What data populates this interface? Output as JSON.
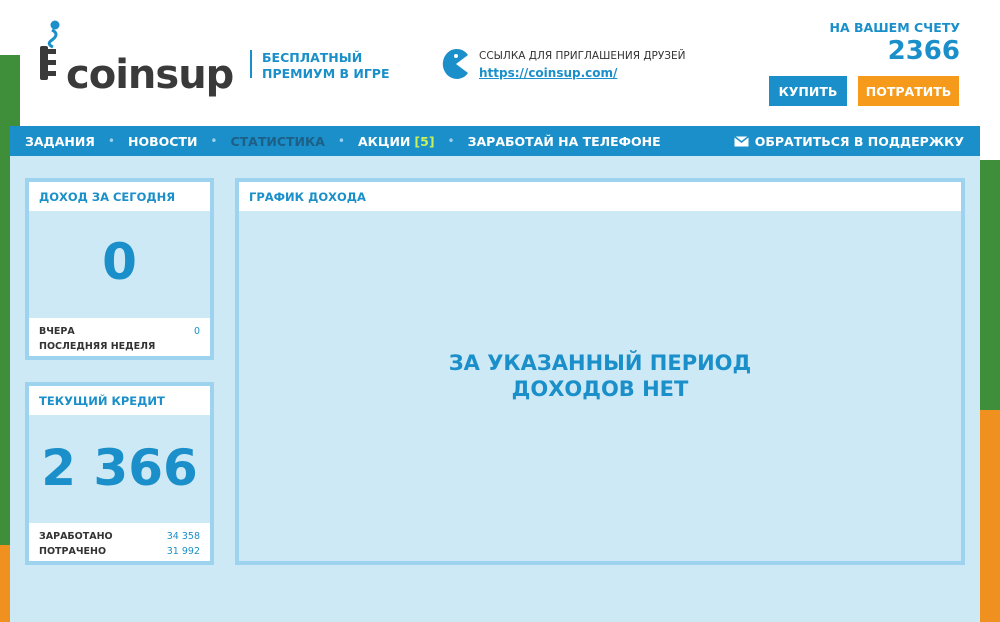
{
  "header": {
    "logo_text": "coinsup",
    "tagline_line1": "БЕСПЛАТНЫЙ",
    "tagline_line2": "ПРЕМИУМ В ИГРЕ",
    "referral_label": "ССЫЛКА ДЛЯ ПРИГЛАШЕНИЯ ДРУЗЕЙ",
    "referral_link": "https://coinsup.com/",
    "account_label": "НА ВАШЕМ СЧЕТУ",
    "account_balance": "2366",
    "buy_label": "КУПИТЬ",
    "spend_label": "ПОТРАТИТЬ"
  },
  "nav": {
    "items": [
      {
        "label": "ЗАДАНИЯ"
      },
      {
        "label": "НОВОСТИ"
      },
      {
        "label": "СТАТИСТИКА",
        "active": true
      },
      {
        "label": "АКЦИИ",
        "badge": "[5]"
      },
      {
        "label": "ЗАРАБОТАЙ НА ТЕЛЕФОНЕ"
      }
    ],
    "support_label": "ОБРАТИТЬСЯ В ПОДДЕРЖКУ"
  },
  "income_today": {
    "title": "ДОХОД ЗА СЕГОДНЯ",
    "value": "0",
    "yesterday_label": "ВЧЕРА",
    "yesterday_value": "0",
    "last_week_label": "ПОСЛЕДНЯЯ НЕДЕЛЯ",
    "last_week_value": ""
  },
  "current_credit": {
    "title": "ТЕКУЩИЙ КРЕДИТ",
    "value": "2 366",
    "earned_label": "ЗАРАБОТАНО",
    "earned_value": "34 358",
    "spent_label": "ПОТРАЧЕНО",
    "spent_value": "31 992"
  },
  "income_chart": {
    "title": "ГРАФИК ДОХОДА",
    "empty_line1": "ЗА УКАЗАННЫЙ ПЕРИОД",
    "empty_line2": "ДОХОДОВ НЕТ"
  },
  "colors": {
    "accent_blue": "#1a8fc9",
    "buy_button": "#1a8fc9",
    "spend_button": "#f59a1a",
    "panel_bg": "#cde9f5",
    "badge": "#c8f05a"
  },
  "icons": {
    "logo": "coinsup-logo-icon",
    "referral": "pacman-icon",
    "support": "envelope-icon"
  }
}
